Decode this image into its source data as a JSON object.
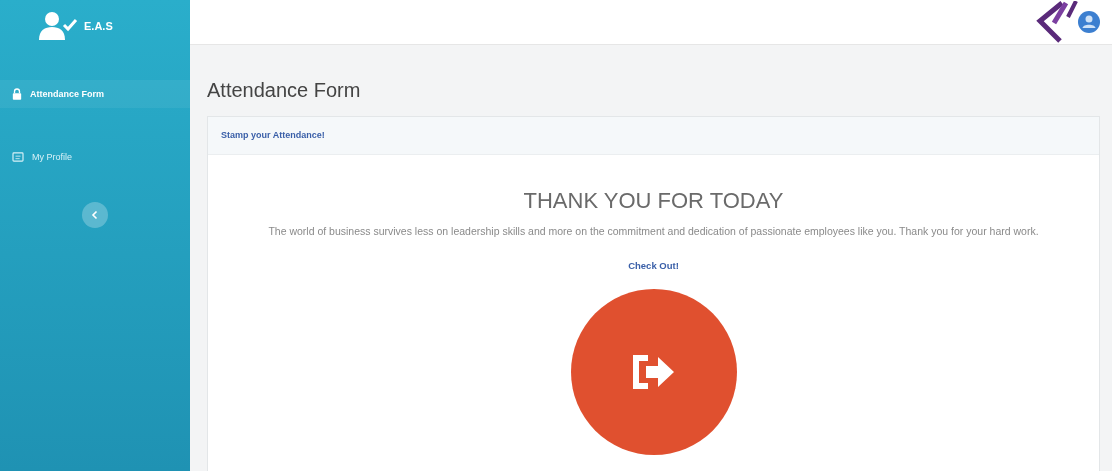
{
  "sidebar": {
    "brand": "E.A.S",
    "items": [
      {
        "label": "Attendance Form",
        "selected": true
      },
      {
        "label": "My Profile",
        "selected": false
      }
    ]
  },
  "page_title": "Attendance Form",
  "card": {
    "header": "Stamp your Attendance!",
    "heading": "THANK YOU FOR TODAY",
    "message": "The world of business survives less on leadership skills and more on the commitment and dedication of passionate employees like you. Thank you for your hard work.",
    "action_label": "Check Out!"
  }
}
